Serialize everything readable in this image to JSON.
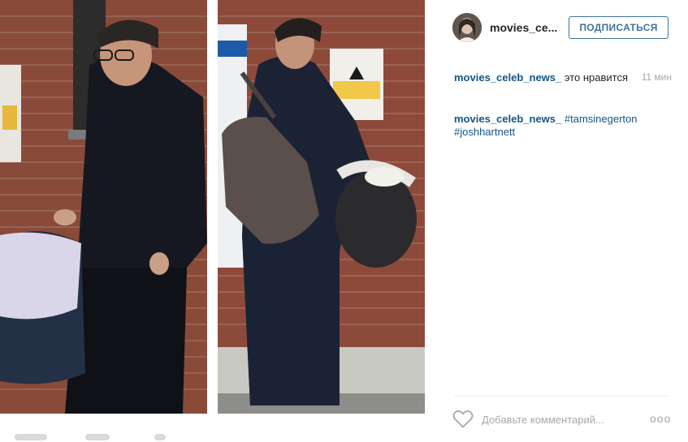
{
  "post": {
    "photos": [
      {
        "name": "left-photo"
      },
      {
        "name": "right-photo"
      }
    ]
  },
  "header": {
    "username": "movies_ce...",
    "follow_label": "ПОДПИСАТЬСЯ"
  },
  "comments": [
    {
      "user": "movies_celeb_news_",
      "text": " это нравится",
      "time": "11 мин"
    },
    {
      "user": "movies_celeb_news_",
      "text": " ",
      "tags": [
        "#tamsinegerton",
        "#joshhartnett"
      ]
    }
  ],
  "footer": {
    "comment_placeholder": "Добавьте комментарий...",
    "more_label": "ооо"
  },
  "colors": {
    "link": "#125688",
    "follow": "#3f729b",
    "muted": "#a5a7aa"
  },
  "icons": [
    "heart-icon",
    "more-options-icon"
  ]
}
